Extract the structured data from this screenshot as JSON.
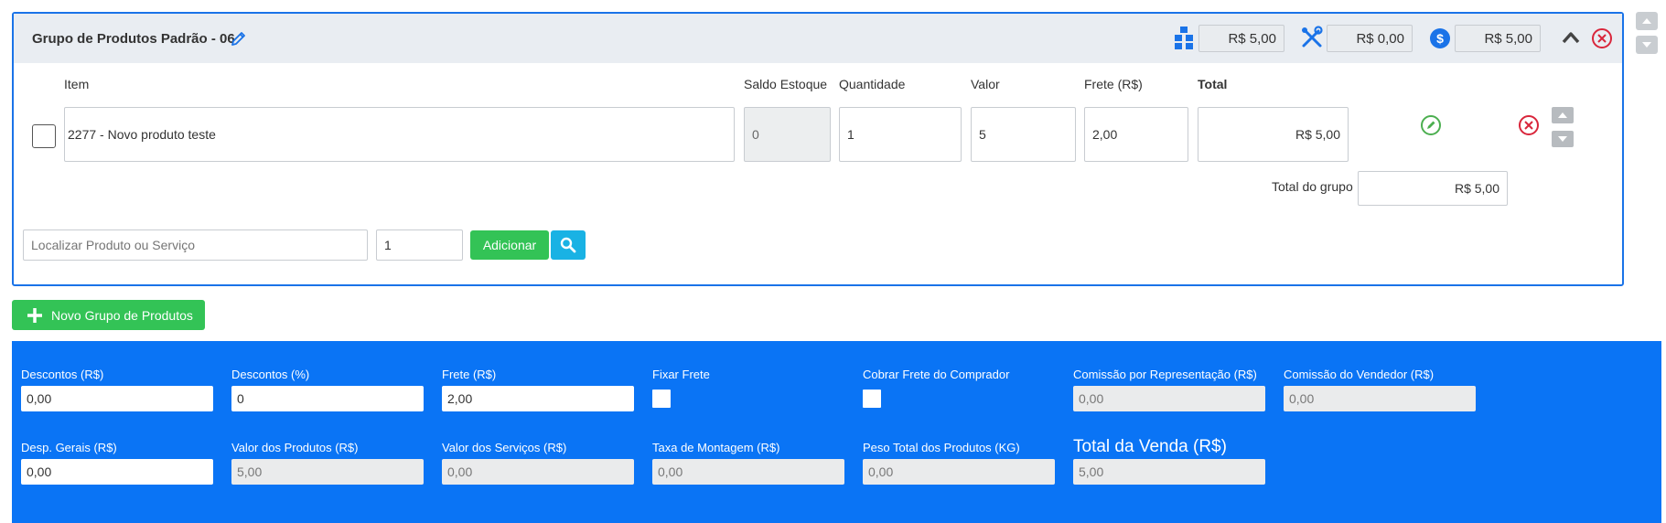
{
  "group": {
    "title": "Grupo de Produtos Padrão - 06",
    "products_total": "R$ 5,00",
    "services_total": "R$ 0,00",
    "group_value": "R$ 5,00"
  },
  "columns": {
    "item": "Item",
    "stock": "Saldo Estoque",
    "quantity": "Quantidade",
    "value": "Valor",
    "freight": "Frete (R$)",
    "total": "Total"
  },
  "item_row": {
    "item": "2277 - Novo produto teste",
    "stock": "0",
    "quantity": "1",
    "value": "5",
    "freight": "2,00",
    "total": "R$ 5,00"
  },
  "group_total": {
    "label": "Total do grupo",
    "value": "R$ 5,00"
  },
  "search": {
    "placeholder": "Localizar Produto ou Serviço",
    "quantity": "1",
    "add_label": "Adicionar"
  },
  "new_group_label": "Novo Grupo de Produtos",
  "footer": {
    "row1": [
      {
        "label": "Descontos (R$)",
        "value": "0,00"
      },
      {
        "label": "Descontos (%)",
        "value": "0"
      },
      {
        "label": "Frete (R$)",
        "value": "2,00"
      },
      {
        "label": "Fixar Frete"
      },
      {
        "label": "Cobrar Frete do Comprador"
      },
      {
        "label": "Comissão por Representação (R$)",
        "value": "0,00"
      },
      {
        "label": "Comissão do Vendedor (R$)",
        "value": "0,00"
      }
    ],
    "row2": [
      {
        "label": "Desp. Gerais (R$)",
        "value": "0,00"
      },
      {
        "label": "Valor dos Produtos (R$)",
        "value": "5,00"
      },
      {
        "label": "Valor dos Serviços (R$)",
        "value": "0,00"
      },
      {
        "label": "Taxa de Montagem (R$)",
        "value": "0,00"
      },
      {
        "label": "Peso Total dos Produtos (KG)",
        "value": "0,00"
      },
      {
        "label": "Total da Venda (R$)",
        "value": "5,00"
      }
    ]
  },
  "colors": {
    "primary_blue": "#0a74f5",
    "green": "#33c356",
    "cyan": "#19b2e4",
    "danger_red": "#d9263b"
  }
}
